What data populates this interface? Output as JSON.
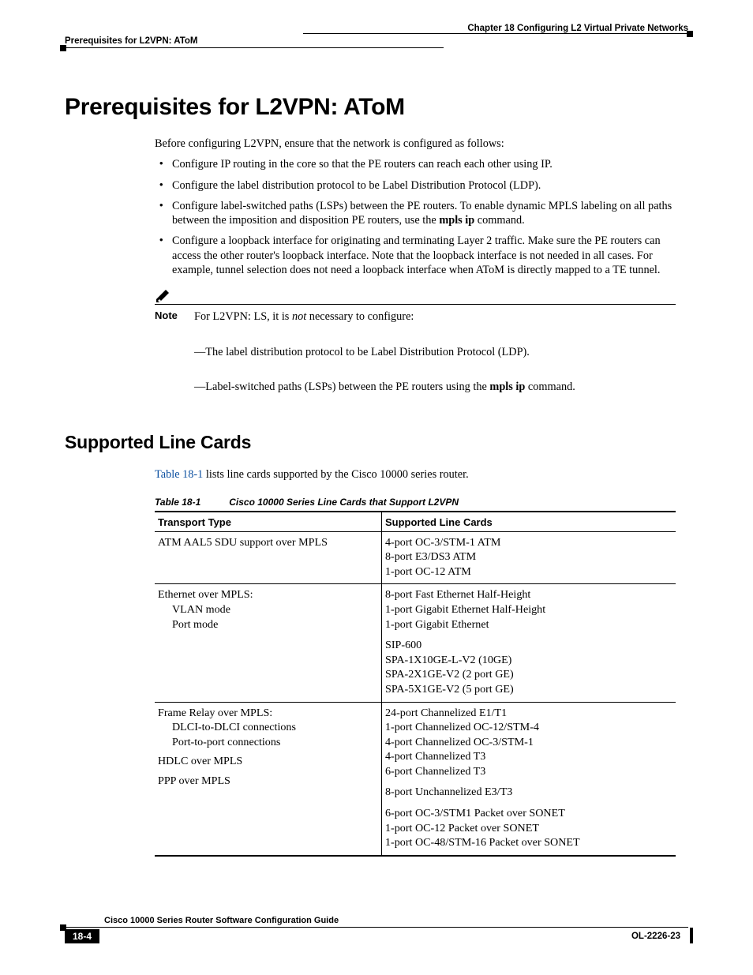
{
  "header": {
    "chapter": "Chapter 18    Configuring L2 Virtual Private Networks",
    "section": "Prerequisites for L2VPN: AToM"
  },
  "h1": "Prerequisites for L2VPN: AToM",
  "intro": "Before configuring L2VPN, ensure that the network is configured as follows:",
  "bullets": [
    "Configure IP routing in the core so that the PE routers can reach each other using IP.",
    "Configure the label distribution protocol to be Label Distribution Protocol (LDP).",
    "Configure label-switched paths (LSPs) between the PE routers. To enable dynamic MPLS labeling on all paths between the imposition and disposition PE routers, use the ",
    "Configure a loopback interface for originating and terminating Layer 2 traffic. Make sure the PE routers can access the other router's loopback interface. Note that the loopback interface is not needed in all cases. For example, tunnel selection does not need a loopback interface when AToM is directly mapped to a TE tunnel."
  ],
  "bullet3_cmd": "mpls ip",
  "bullet3_tail": " command.",
  "note": {
    "label": "Note",
    "line1_a": "For L2VPN: LS, it is ",
    "line1_i": "not",
    "line1_b": " necessary to configure:",
    "dash1": "—The label distribution protocol to be Label Distribution Protocol (LDP).",
    "dash2_a": "—Label-switched paths (LSPs) between the PE routers using the ",
    "dash2_cmd": "mpls ip",
    "dash2_b": " command."
  },
  "h2": "Supported Line Cards",
  "table_intro_link": "Table 18-1",
  "table_intro_rest": " lists line cards supported by the Cisco 10000 series router.",
  "table": {
    "number": "Table 18-1",
    "caption": "Cisco 10000 Series Line Cards that Support L2VPN",
    "headers": [
      "Transport Type",
      "Supported Line Cards"
    ],
    "rows": [
      {
        "left": {
          "lines": [
            "ATM AAL5 SDU support over MPLS"
          ]
        },
        "right": [
          [
            "4-port OC-3/STM-1 ATM",
            "8-port E3/DS3 ATM",
            "1-port OC-12 ATM"
          ]
        ]
      },
      {
        "left": {
          "lines": [
            "Ethernet over MPLS:"
          ],
          "sub": [
            "VLAN mode",
            "Port mode"
          ]
        },
        "right": [
          [
            "8-port Fast Ethernet Half-Height",
            "1-port Gigabit Ethernet Half-Height",
            "1-port Gigabit Ethernet"
          ],
          [
            "SIP-600",
            "SPA-1X10GE-L-V2 (10GE)",
            "SPA-2X1GE-V2 (2 port GE)",
            "SPA-5X1GE-V2 (5 port GE)"
          ]
        ]
      },
      {
        "left": {
          "lines": [
            "Frame Relay over MPLS:"
          ],
          "sub": [
            "DLCI-to-DLCI connections",
            "Port-to-port connections"
          ],
          "extra": [
            "HDLC over MPLS",
            "PPP over MPLS"
          ]
        },
        "right": [
          [
            "24-port Channelized E1/T1",
            "1-port Channelized OC-12/STM-4",
            "4-port Channelized OC-3/STM-1",
            "4-port Channelized T3",
            "6-port Channelized T3"
          ],
          [
            "8-port Unchannelized E3/T3"
          ],
          [
            "6-port OC-3/STM1 Packet over SONET",
            "1-port OC-12 Packet over SONET",
            "1-port OC-48/STM-16 Packet over SONET"
          ]
        ]
      }
    ]
  },
  "footer": {
    "title": "Cisco 10000 Series Router Software Configuration Guide",
    "page": "18-4",
    "docid": "OL-2226-23"
  }
}
